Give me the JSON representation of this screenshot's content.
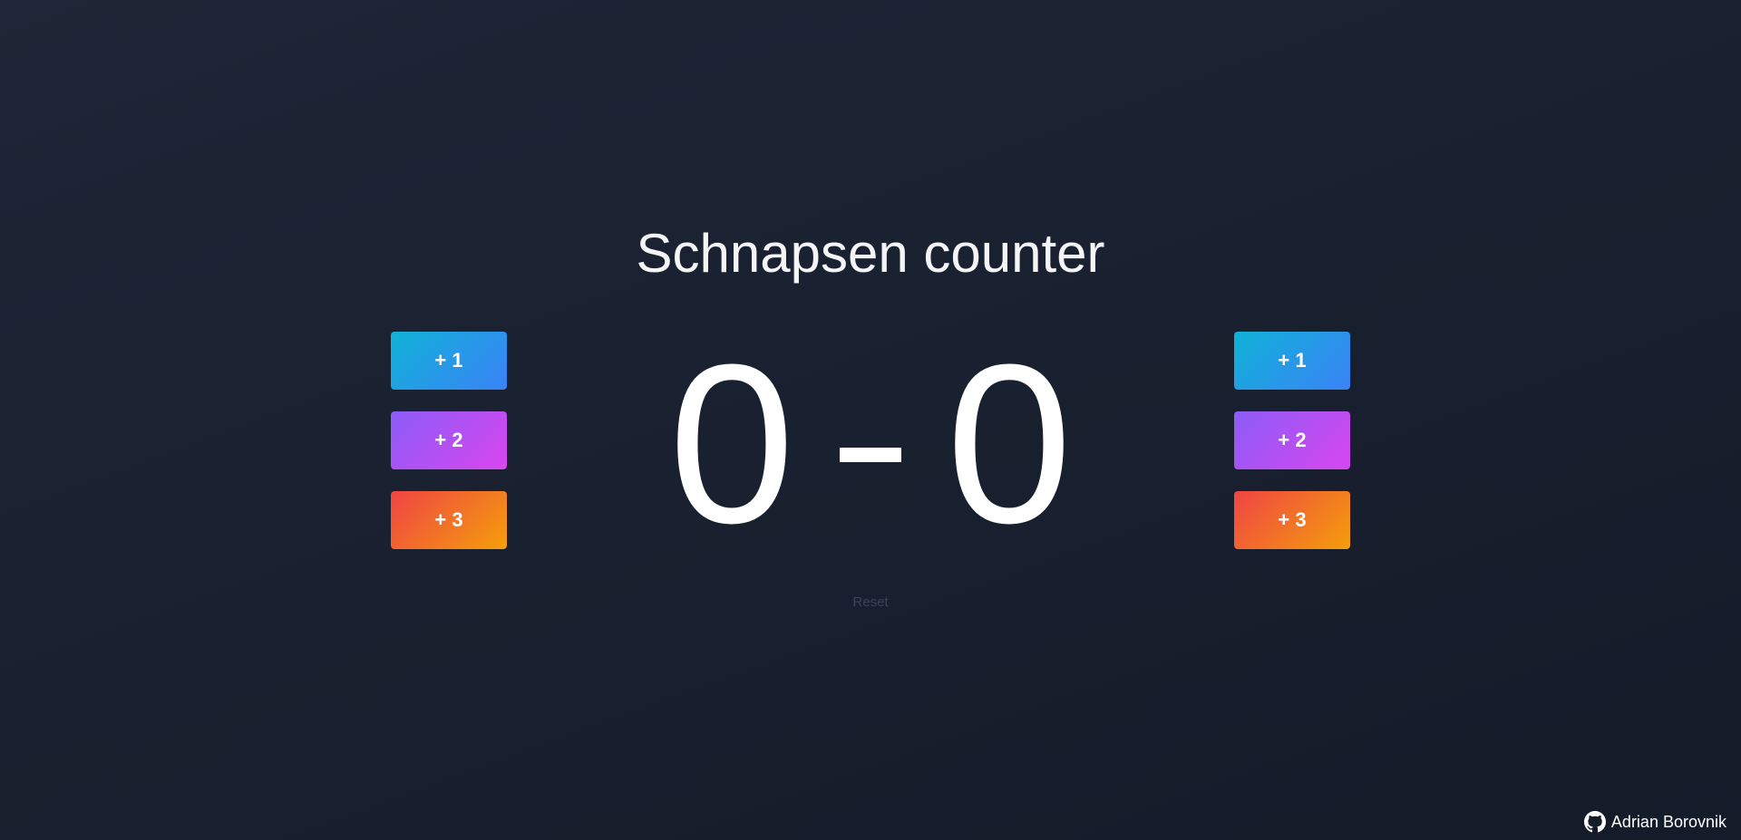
{
  "title": "Schnapsen counter",
  "left_player": {
    "score": "0",
    "buttons": [
      {
        "label": "+ 1",
        "style": "plus1"
      },
      {
        "label": "+ 2",
        "style": "plus2"
      },
      {
        "label": "+ 3",
        "style": "plus3"
      }
    ]
  },
  "right_player": {
    "score": "0",
    "buttons": [
      {
        "label": "+ 1",
        "style": "plus1"
      },
      {
        "label": "+ 2",
        "style": "plus2"
      },
      {
        "label": "+ 3",
        "style": "plus3"
      }
    ]
  },
  "separator": "-",
  "reset_label": "Reset",
  "footer": {
    "author": "Adrian Borovnik",
    "icon": "github-icon"
  },
  "colors": {
    "background": "#19202f",
    "text": "#ffffff",
    "reset_text": "#3a4559",
    "plus1_gradient": [
      "#10b2d8",
      "#3b82f6"
    ],
    "plus2_gradient": [
      "#8b5cf6",
      "#d946ef"
    ],
    "plus3_gradient": [
      "#ef4444",
      "#f59e0b"
    ]
  }
}
